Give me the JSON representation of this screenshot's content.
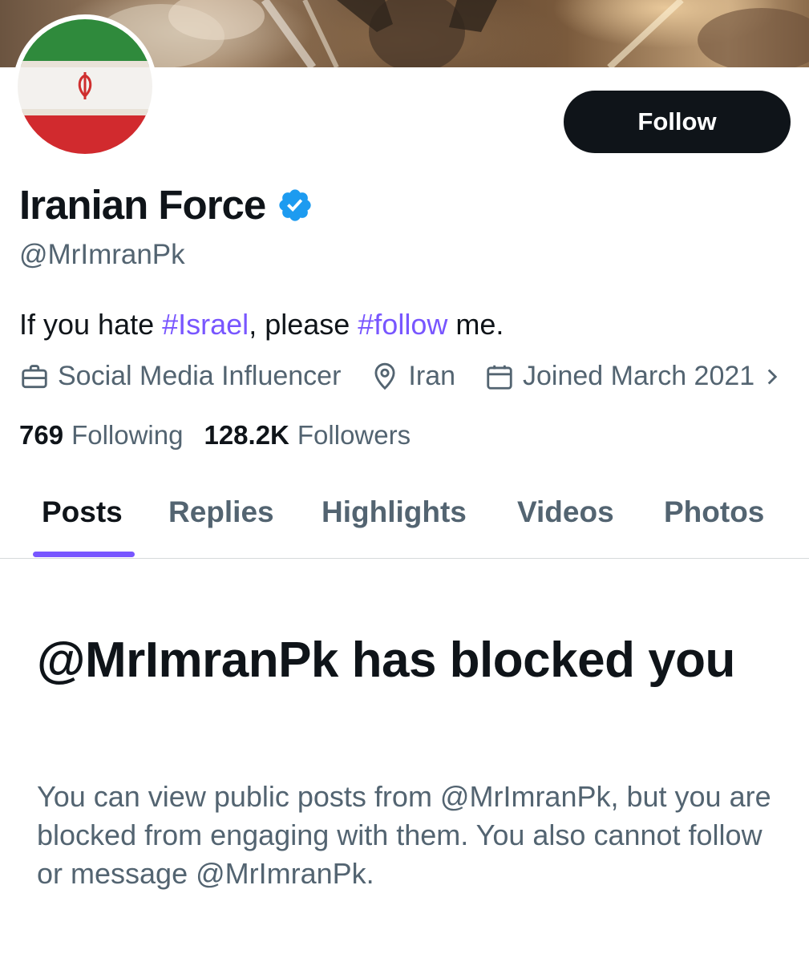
{
  "profile": {
    "display_name": "Iranian Force",
    "handle": "@MrImranPk",
    "verified": true,
    "follow_label": "Follow",
    "bio": {
      "part1": "If you hate ",
      "tag1": "#Israel",
      "part2": ", please ",
      "tag2": "#follow",
      "part3": " me."
    },
    "meta": {
      "category": "Social Media Influencer",
      "location": "Iran",
      "joined": "Joined March 2021"
    },
    "stats": {
      "following_count": "769",
      "following_label": "Following",
      "followers_count": "128.2K",
      "followers_label": "Followers"
    }
  },
  "tabs": [
    {
      "label": "Posts",
      "active": true
    },
    {
      "label": "Replies",
      "active": false
    },
    {
      "label": "Highlights",
      "active": false
    },
    {
      "label": "Videos",
      "active": false
    },
    {
      "label": "Photos",
      "active": false
    }
  ],
  "blocked": {
    "title": "@MrImranPk has blocked you",
    "body": "You can view public posts from @MrImranPk, but you are blocked from engaging with them. You also cannot follow or message @MrImranPk."
  },
  "icons": {
    "category": "briefcase-icon",
    "location": "location-pin-icon",
    "joined": "calendar-icon",
    "more": "chevron-right-icon",
    "verified": "verified-badge-icon"
  },
  "colors": {
    "accent": "#7856ff",
    "verified": "#1d9bf0",
    "text_primary": "#0f1419",
    "text_secondary": "#536471",
    "button_bg": "#0f1419"
  }
}
